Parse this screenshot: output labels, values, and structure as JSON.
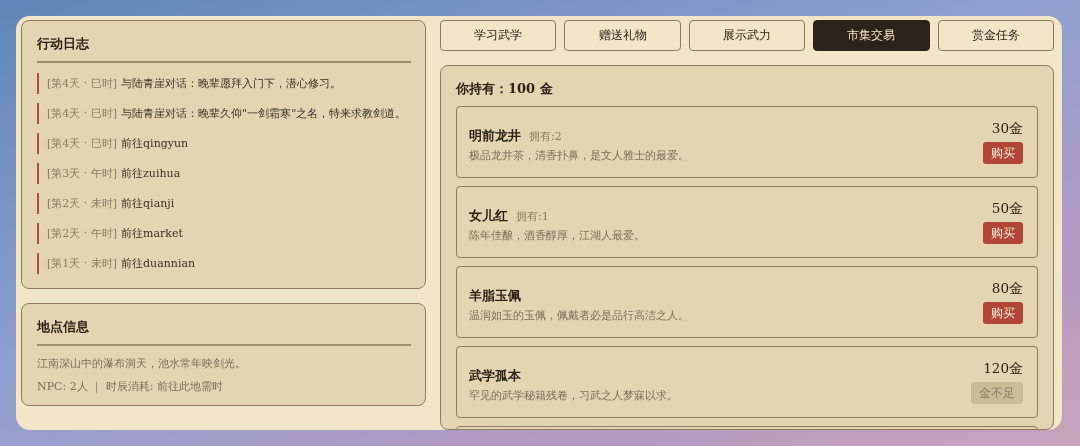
{
  "log": {
    "title": "行动日志",
    "entries": [
      {
        "time": "[第4天 · 巳时]",
        "text": "与陆青崖对话：晚辈愿拜入门下，潜心修习。"
      },
      {
        "time": "[第4天 · 巳时]",
        "text": "与陆青崖对话：晚辈久仰\"一剑霜寒\"之名，特来求教剑道。"
      },
      {
        "time": "[第4天 · 巳时]",
        "text": "前往qingyun"
      },
      {
        "time": "[第3天 · 午时]",
        "text": "前往zuihua"
      },
      {
        "time": "[第2天 · 未时]",
        "text": "前往qianji"
      },
      {
        "time": "[第2天 · 午时]",
        "text": "前往market"
      },
      {
        "time": "[第1天 · 未时]",
        "text": "前往duannian"
      }
    ]
  },
  "location": {
    "title": "地点信息",
    "description": "江南深山中的瀑布洞天，池水常年映剑光。",
    "meta": "NPC: 2人 ｜ 时辰消耗: 前往此地需时"
  },
  "tabs": [
    {
      "label": "学习武学",
      "selected": false
    },
    {
      "label": "赠送礼物",
      "selected": false
    },
    {
      "label": "展示武力",
      "selected": false
    },
    {
      "label": "市集交易",
      "selected": true
    },
    {
      "label": "赏金任务",
      "selected": false
    }
  ],
  "shop": {
    "gold": "你持有：100 金",
    "items": [
      {
        "name": "明前龙井",
        "owned": "拥有:2",
        "description": "极品龙井茶，清香扑鼻，是文人雅士的最爱。",
        "price": "30金",
        "button": "购买",
        "disabled": false
      },
      {
        "name": "女儿红",
        "owned": "拥有:1",
        "description": "陈年佳酿，酒香醇厚，江湖人最爱。",
        "price": "50金",
        "button": "购买",
        "disabled": false
      },
      {
        "name": "羊脂玉佩",
        "description": "温润如玉的玉佩，佩戴者必是品行高洁之人。",
        "price": "80金",
        "button": "购买",
        "disabled": false
      },
      {
        "name": "武学孤本",
        "description": "罕见的武学秘籍残卷，习武之人梦寐以求。",
        "price": "120金",
        "button": "金不足",
        "disabled": true
      }
    ]
  }
}
